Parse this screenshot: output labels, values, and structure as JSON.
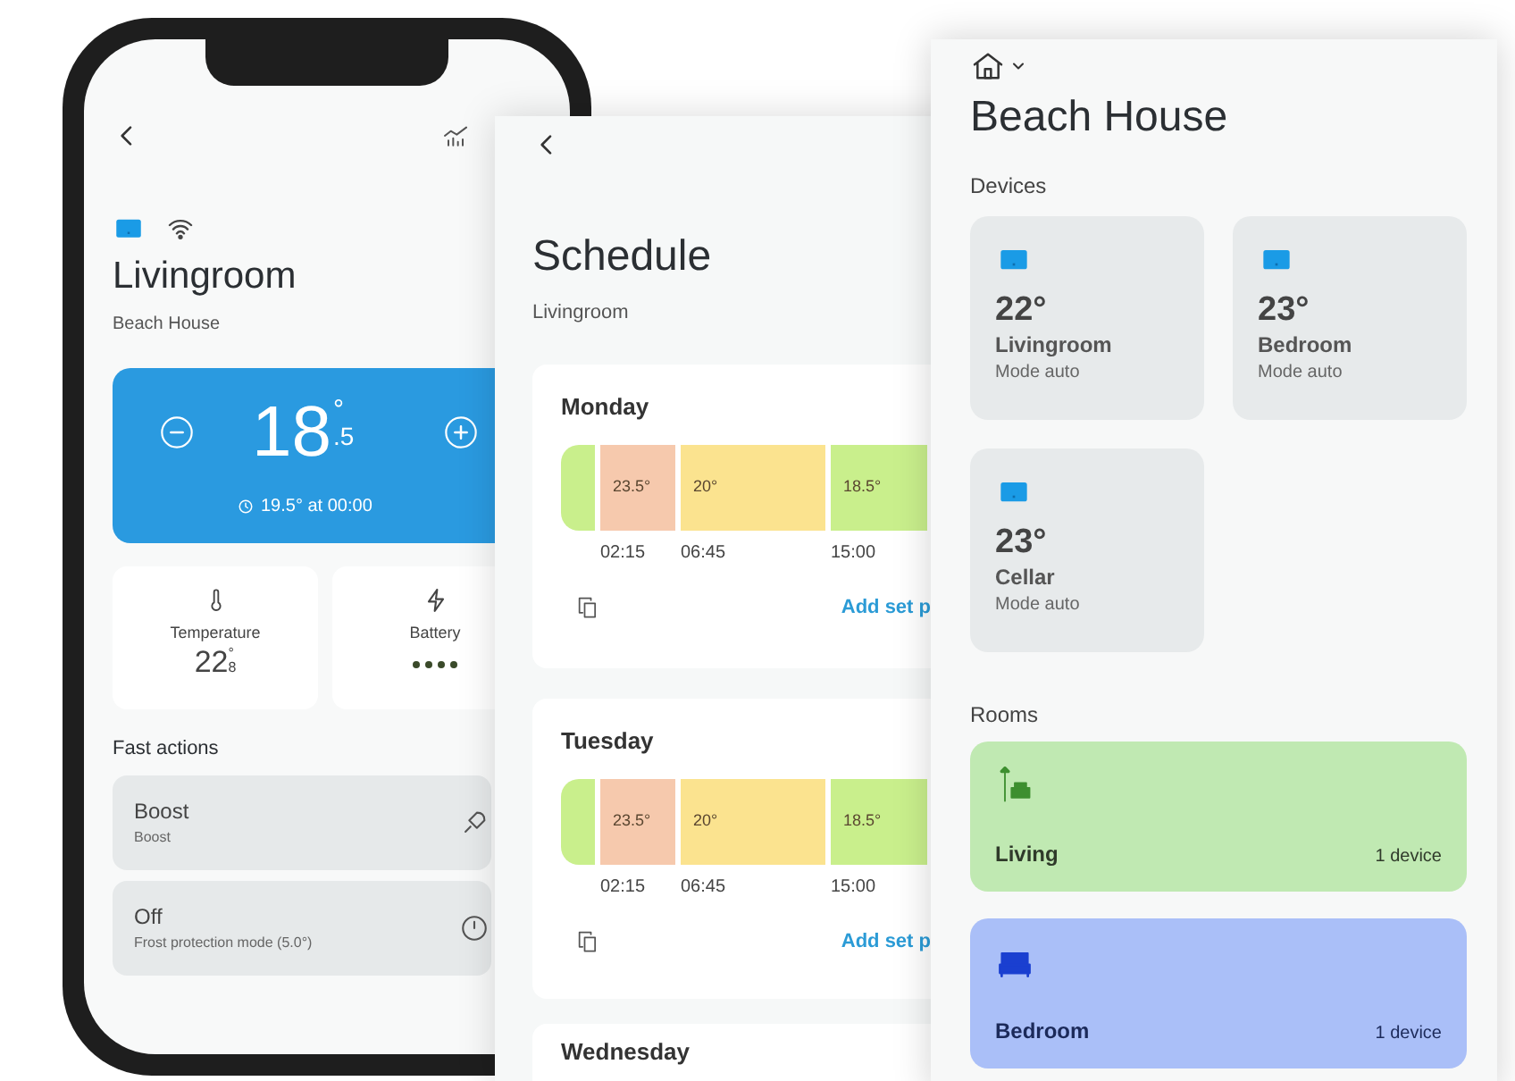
{
  "thermostat_screen": {
    "title": "Livingroom",
    "subtitle": "Beach House",
    "setpoint": {
      "whole": "18",
      "degree": "°",
      "decimal": ".5",
      "next": "19.5° at 00:00"
    },
    "stats": [
      {
        "kind": "temperature",
        "label": "Temperature",
        "whole": "22",
        "degree": "°",
        "decimal": "8"
      },
      {
        "kind": "battery",
        "label": "Battery"
      }
    ],
    "fast_actions": {
      "heading": "Fast actions",
      "items": [
        {
          "kind": "boost",
          "title": "Boost",
          "subtitle": "Boost"
        },
        {
          "kind": "off",
          "title": "Off",
          "subtitle": "Frost protection mode (5.0°)"
        }
      ]
    }
  },
  "schedule_screen": {
    "title": "Schedule",
    "subtitle": "Livingroom",
    "days": [
      {
        "name": "Monday",
        "segments": [
          {
            "color": "#c9ef8c"
          },
          {
            "label": "23.5°",
            "start": "02:15",
            "color": "#f6c9ad"
          },
          {
            "label": "20°",
            "start": "06:45",
            "color": "#fbe38f"
          },
          {
            "label": "18.5°",
            "start": "15:00",
            "color": "#c9ef8c"
          }
        ],
        "add_link": "Add set p"
      },
      {
        "name": "Tuesday",
        "segments": [
          {
            "color": "#c9ef8c"
          },
          {
            "label": "23.5°",
            "start": "02:15",
            "color": "#f6c9ad"
          },
          {
            "label": "20°",
            "start": "06:45",
            "color": "#fbe38f"
          },
          {
            "label": "18.5°",
            "start": "15:00",
            "color": "#c9ef8c"
          }
        ],
        "add_link": "Add set p"
      },
      {
        "name": "Wednesday"
      }
    ]
  },
  "home_screen": {
    "title": "Beach House",
    "devices_heading": "Devices",
    "devices": [
      {
        "temperature": "22°",
        "name": "Livingroom",
        "mode": "Mode auto"
      },
      {
        "temperature": "23°",
        "name": "Bedroom",
        "mode": "Mode auto"
      },
      {
        "temperature": "23°",
        "name": "Cellar",
        "mode": "Mode auto"
      }
    ],
    "rooms_heading": "Rooms",
    "rooms": [
      {
        "kind": "living",
        "name": "Living",
        "count": "1 device",
        "color": "#c0e9b2"
      },
      {
        "kind": "bedroom",
        "name": "Bedroom",
        "count": "1 device",
        "color": "#aabff8"
      }
    ]
  }
}
